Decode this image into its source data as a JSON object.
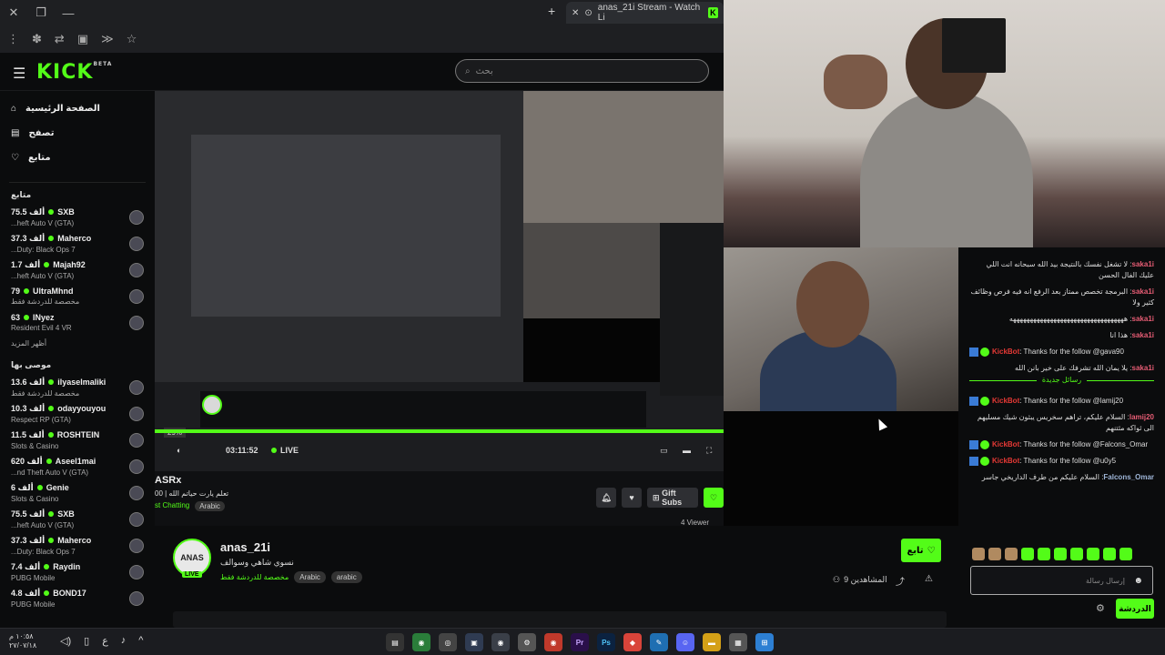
{
  "browser": {
    "tab_title": "anas_21i Stream - Watch Li",
    "tab_favicon": "K"
  },
  "header": {
    "logo": "KICK",
    "logo_badge": "BETA",
    "search_placeholder": "بحث"
  },
  "sidebar": {
    "nav": [
      {
        "label": "الصفحة الرئيسية",
        "icon": "home-icon"
      },
      {
        "label": "تصفح",
        "icon": "browse-icon"
      },
      {
        "label": "متابع",
        "icon": "heart-icon"
      }
    ],
    "following_title": "متابع",
    "following": [
      {
        "name": "SXB",
        "viewers": "75.5 ألف",
        "game": "...heft Auto V (GTA)"
      },
      {
        "name": "Maherco",
        "viewers": "37.3 ألف",
        "game": "...Duty: Black Ops 7"
      },
      {
        "name": "Majah92",
        "viewers": "1.7 ألف",
        "game": "...heft Auto V (GTA)"
      },
      {
        "name": "UltraMhnd",
        "viewers": "79",
        "game": "مخصصة للدردشة فقط"
      },
      {
        "name": "INyez",
        "viewers": "63",
        "game": "Resident Evil 4 VR"
      }
    ],
    "show_more": "أظهر المزيد",
    "recommended_title": "موصى بها",
    "recommended": [
      {
        "name": "ilyaselmaliki",
        "viewers": "13.6 ألف",
        "game": "مخصصة للدردشة فقط"
      },
      {
        "name": "odayyouyou",
        "viewers": "10.3 ألف",
        "game": "Respect RP (GTA)"
      },
      {
        "name": "ROSHTEIN",
        "viewers": "11.5 ألف",
        "game": "Slots & Casino"
      },
      {
        "name": "Aseel1mai",
        "viewers": "620 ألف",
        "game": "...nd Theft Auto V (GTA)"
      },
      {
        "name": "Genie",
        "viewers": "6 ألف",
        "game": "Slots & Casino"
      },
      {
        "name": "SXB",
        "viewers": "75.5 ألف",
        "game": "...heft Auto V (GTA)"
      },
      {
        "name": "Maherco",
        "viewers": "37.3 ألف",
        "game": "...Duty: Black Ops 7"
      },
      {
        "name": "Raydin",
        "viewers": "7.4 ألف",
        "game": "PUBG Mobile"
      },
      {
        "name": "BOND17",
        "viewers": "4.8 ألف",
        "game": "PUBG Mobile"
      }
    ]
  },
  "player": {
    "time": "03:11:52",
    "live": "LIVE",
    "volume": "29%",
    "progress": 1.0,
    "inner_streamer": "ASRx",
    "inner_title": "تعلم يارت حياتم الله | 00",
    "inner_category": "st Chatting",
    "inner_tag": "Arabic",
    "gift_subs": "Gift Subs",
    "inner_viewers": "4 Viewer"
  },
  "channel": {
    "avatar_text": "ANAS",
    "live_badge": "LIVE",
    "name": "anas_21i",
    "title": "نسوي شاهي وسوالف",
    "category": "مخصصة للدردشة فقط",
    "tags": [
      "Arabic",
      "arabic"
    ],
    "follow_label": "تابع",
    "viewers": "9 المشاهدين"
  },
  "chat": {
    "messages": [
      {
        "user": "saka1i",
        "text": "لا تشغل نفسك بالنتيجة بيد الله سبحانه انت اللي عليك الفال الحسن"
      },
      {
        "user": "saka1i",
        "text": "البرمجة تخصص ممتاز بعد الرفع انه فيه فرص وظائف كثير ولا"
      },
      {
        "user": "saka1i",
        "text": "ههههههههههههههههههههههههههههههههههه"
      },
      {
        "user": "saka1i",
        "text": "هذا انا"
      },
      {
        "user": "KickBot",
        "text": "Thanks for the follow @gava90",
        "bot": true
      },
      {
        "user": "saka1i",
        "text": "يلا يمان الله تشرفك على خير بانن الله"
      }
    ],
    "new_messages": "رسائل جديدة",
    "messages2": [
      {
        "user": "KickBot",
        "text": "Thanks for the follow @lamij20",
        "bot": true
      },
      {
        "user": "lamij20",
        "text": "السلام عليكم، تراهم سخريس يبثون شيك مسليهم الى ثواكه مثتنهم"
      },
      {
        "user": "KickBot",
        "text": "Thanks for the follow @Falcons_Omar",
        "bot": true
      },
      {
        "user": "KickBot",
        "text": "Thanks for the follow @u0y5",
        "bot": true
      },
      {
        "user": "Falcons_Omar",
        "text": "السلام عليكم من طرف الداريخي جاسر"
      }
    ],
    "input_placeholder": "إرسال رسالة",
    "send_label": "الدردشة"
  },
  "taskbar": {
    "time": "١٠:٥٨ م",
    "date": "٢٧/٠٧/١٨"
  }
}
